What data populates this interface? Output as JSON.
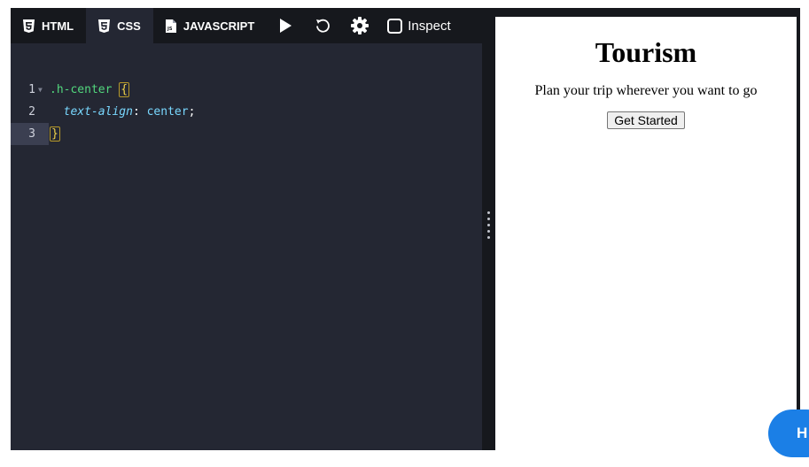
{
  "toolbar": {
    "tabs": [
      {
        "label": "HTML",
        "icon": "html5-icon"
      },
      {
        "label": "CSS",
        "icon": "css3-icon"
      },
      {
        "label": "JAVASCRIPT",
        "icon": "js-file-icon"
      }
    ],
    "active_tab": "CSS",
    "run_icon": "play-icon",
    "reset_icon": "undo-icon",
    "settings_icon": "gear-icon",
    "inspect_label": "Inspect"
  },
  "editor": {
    "lines": [
      {
        "number": "1",
        "selector": ".h-center",
        "open_brace": "{"
      },
      {
        "number": "2",
        "property": "text-align",
        "colon": ": ",
        "value": "center",
        "semicolon": ";"
      },
      {
        "number": "3",
        "close_brace": "}"
      }
    ]
  },
  "preview": {
    "heading": "Tourism",
    "paragraph": "Plan your trip wherever you want to go",
    "button_label": "Get Started"
  },
  "help_button": {
    "label": "H"
  },
  "colors": {
    "toolbar_bg": "#16181d",
    "editor_bg": "#242733",
    "selector": "#52d77d",
    "property": "#79d8ff",
    "brace": "#f0d34a",
    "help_bubble": "#1b7fe6"
  }
}
